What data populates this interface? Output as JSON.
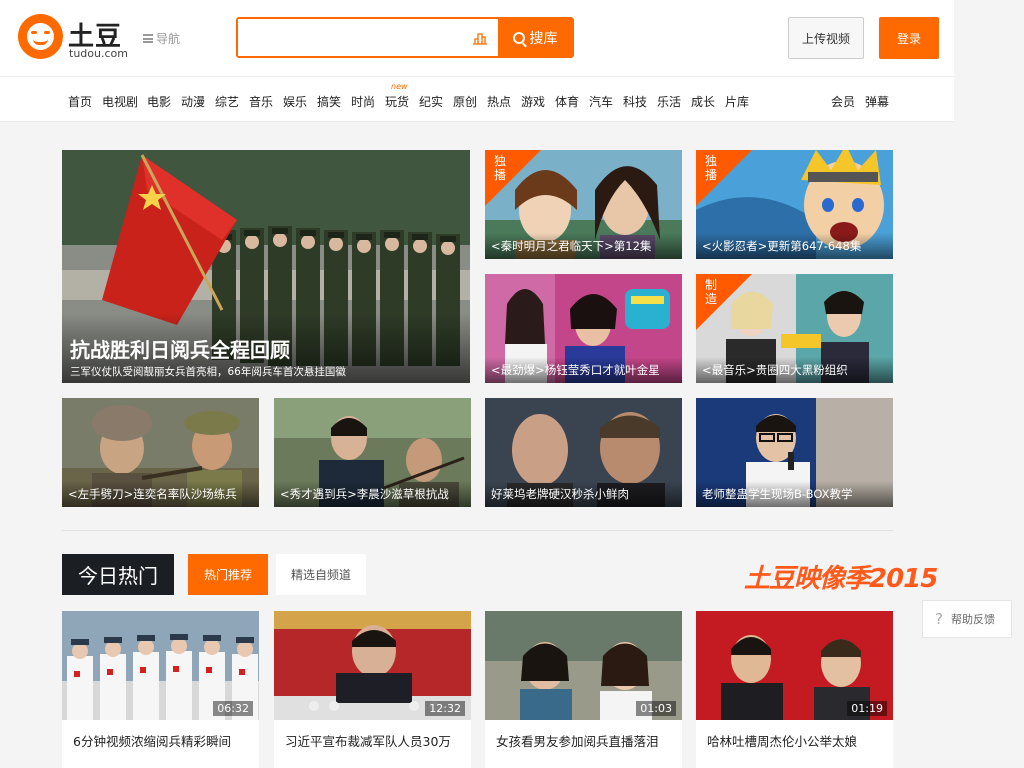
{
  "header": {
    "logo_name": "土豆",
    "logo_domain": "tudou.com",
    "nav_toggle_label": "导航",
    "search": {
      "value": "",
      "placeholder": "",
      "button_label": "搜库"
    },
    "upload_label": "上传视频",
    "login_label": "登录"
  },
  "nav": {
    "items": [
      "首页",
      "电视剧",
      "电影",
      "动漫",
      "综艺",
      "音乐",
      "娱乐",
      "搞笑",
      "时尚",
      "玩货",
      "纪实",
      "原创",
      "热点",
      "游戏",
      "体育",
      "汽车",
      "科技",
      "乐活",
      "成长",
      "片库"
    ],
    "new_badge": "new",
    "right_items": [
      "会员",
      "弹幕"
    ]
  },
  "featured": {
    "big": {
      "title": "抗战胜利日阅兵全程回顾",
      "subtitle": "三军仪仗队受阅靓丽女兵首亮相，66年阅兵车首次悬挂国徽"
    },
    "tiles": [
      {
        "caption": "<秦时明月之君临天下>第12集",
        "badge": "独播"
      },
      {
        "caption": "<火影忍者>更新第647-648集",
        "badge": "独播"
      },
      {
        "caption": "<最劲爆>杨钰莹秀口才就叶金星",
        "badge": ""
      },
      {
        "caption": "<最音乐>贵圈四大黑粉组织",
        "badge": "制造"
      },
      {
        "caption": "<左手劈刀>连奕名率队沙场练兵",
        "badge": ""
      },
      {
        "caption": "<秀才遇到兵>李晨沙滋草根抗战",
        "badge": ""
      },
      {
        "caption": "好莱坞老牌硬汉秒杀小鲜肉",
        "badge": ""
      },
      {
        "caption": "老师整蛊学生现场B-BOX教学",
        "badge": ""
      }
    ]
  },
  "hot": {
    "section_title": "今日热门",
    "tabs": [
      "热门推荐",
      "精选自频道"
    ],
    "brand": "土豆映像季2015",
    "videos": [
      {
        "title": "6分钟视频浓缩阅兵精彩瞬间",
        "duration": "06:32"
      },
      {
        "title": "习近平宣布裁减军队人员30万",
        "duration": "12:32"
      },
      {
        "title": "女孩看男友参加阅兵直播落泪",
        "duration": "01:03"
      },
      {
        "title": "哈林吐槽周杰伦小公举太娘",
        "duration": "01:19"
      }
    ]
  },
  "feedback_label": "帮助反馈",
  "colors": {
    "accent": "#ff6a00",
    "dark": "#1b1e22"
  }
}
